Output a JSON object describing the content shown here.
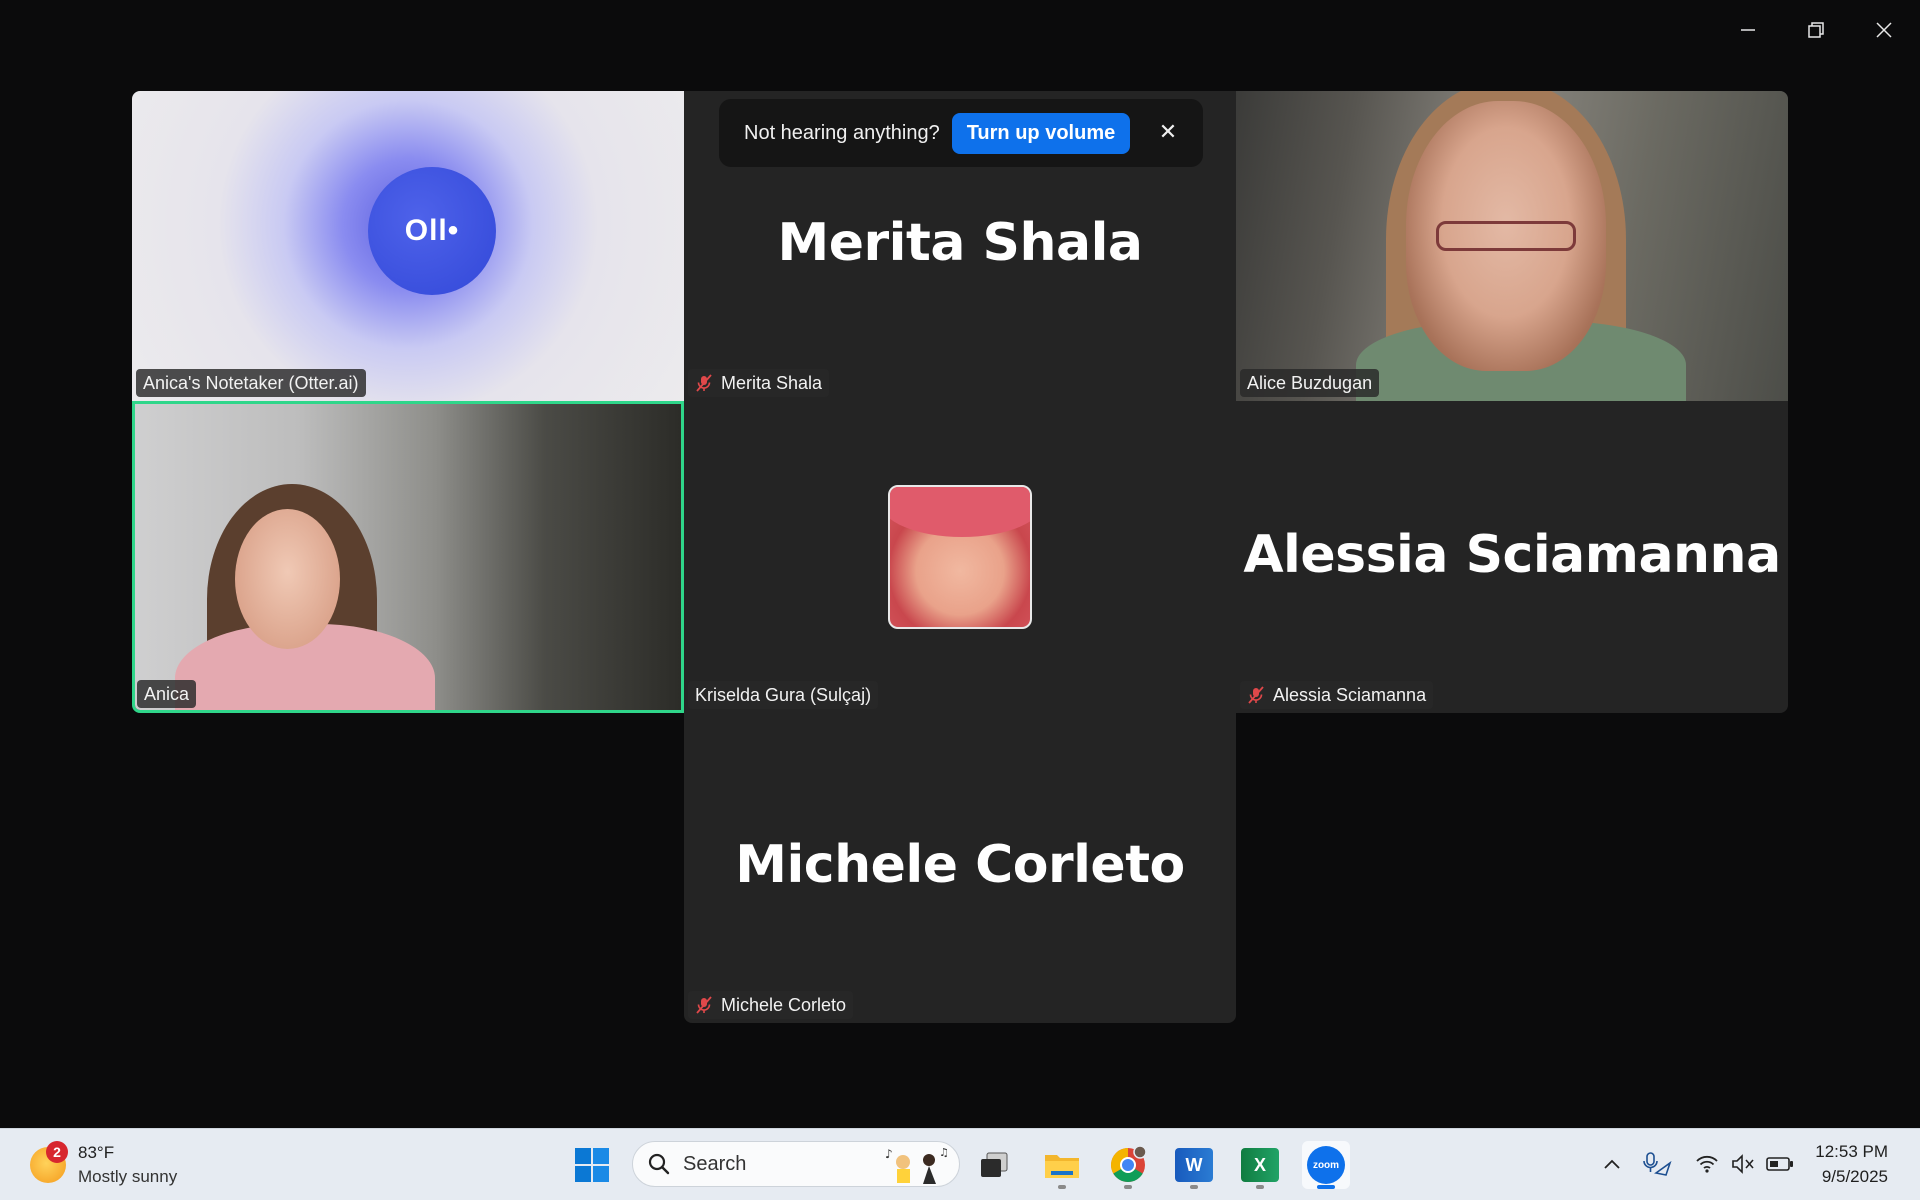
{
  "banner": {
    "message": "Not hearing anything?",
    "button_label": "Turn up volume",
    "close_glyph": "✕"
  },
  "tiles": {
    "otter": {
      "name": "Anica's Notetaker (Otter.ai)",
      "logo_text": "Oll•"
    },
    "merita": {
      "display_name": "Merita Shala",
      "tag": "Merita Shala"
    },
    "alice": {
      "tag": "Alice Buzdugan"
    },
    "anica": {
      "tag": "Anica"
    },
    "kriselda": {
      "tag": "Kriselda Gura (Sulçaj)"
    },
    "alessia": {
      "display_name": "Alessia Sciamanna",
      "tag": "Alessia Sciamanna"
    },
    "michele": {
      "display_name": "Michele Corleto",
      "tag": "Michele Corleto"
    }
  },
  "colors": {
    "active_speaker_border": "#2fd68a",
    "muted_mic": "#e0484a",
    "zoom_blue": "#0e71eb"
  },
  "taskbar": {
    "weather": {
      "temp": "83°F",
      "condition": "Mostly sunny",
      "badge": "2"
    },
    "search_placeholder": "Search",
    "apps": [
      "windows-start",
      "search",
      "task-view",
      "file-explorer",
      "chrome",
      "word",
      "excel",
      "zoom"
    ],
    "zoom_label": "zoom",
    "word_label": "W",
    "excel_label": "X",
    "tray_icons": [
      "chevron-up",
      "mic",
      "wifi",
      "volume-muted",
      "battery"
    ],
    "time": "12:53 PM",
    "date": "9/5/2025"
  }
}
